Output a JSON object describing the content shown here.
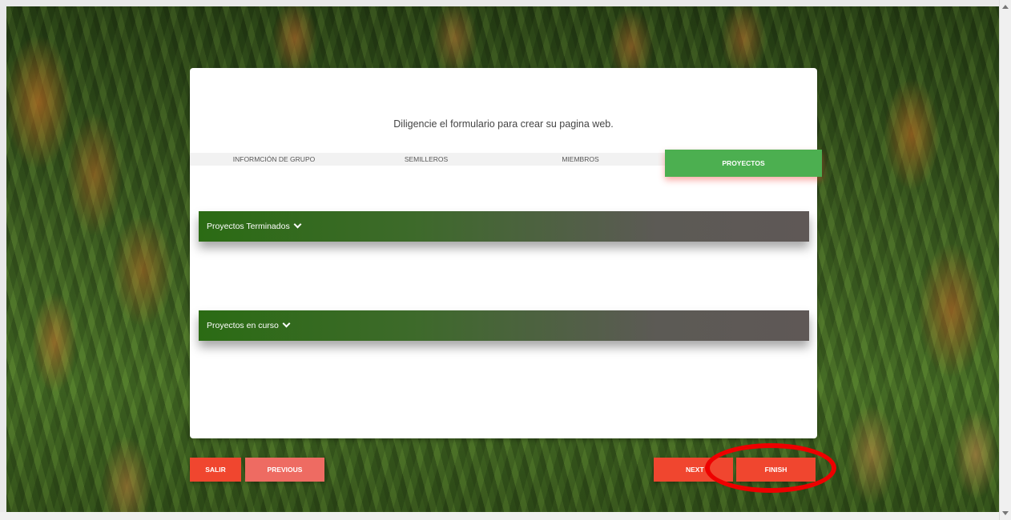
{
  "form": {
    "subtitle": "Diligencie el formulario para crear su pagina web.",
    "tabs": [
      {
        "label": "INFORMCIÓN DE GRUPO"
      },
      {
        "label": "SEMILLEROS"
      },
      {
        "label": "MIEMBROS"
      },
      {
        "label": "PROYECTOS",
        "active": true
      }
    ],
    "sections": [
      {
        "label": "Proyectos Terminados"
      },
      {
        "label": "Proyectos en curso"
      }
    ]
  },
  "buttons": {
    "salir": "SALIR",
    "previous": "PREVIOUS",
    "next": "NEXT",
    "finish": "FINISH"
  },
  "colors": {
    "tab_active": "#4caf50",
    "button": "#f0462f",
    "button_light": "#ee6b62",
    "highlight_ring": "#ee0000"
  }
}
